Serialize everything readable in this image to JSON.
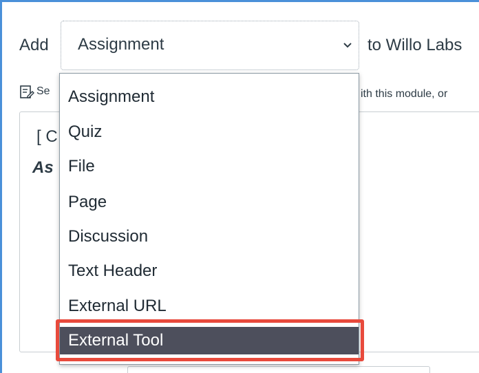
{
  "module_add": {
    "add_label": "Add",
    "selected_type": "Assignment",
    "to_label": "to Willo Labs",
    "info_text_left": "Se",
    "info_text_right": "ith this module, or",
    "content_line1": "[ C",
    "content_line2": "As"
  },
  "dropdown": {
    "options": [
      {
        "label": "Assignment",
        "selected": false
      },
      {
        "label": "Quiz",
        "selected": false
      },
      {
        "label": "File",
        "selected": false
      },
      {
        "label": "Page",
        "selected": false
      },
      {
        "label": "Discussion",
        "selected": false
      },
      {
        "label": "Text Header",
        "selected": false
      },
      {
        "label": "External URL",
        "selected": false
      },
      {
        "label": "External Tool",
        "selected": true
      }
    ]
  },
  "annotation": {
    "highlight_color": "#e84a3c",
    "highlighted_option": "External Tool"
  },
  "colors": {
    "frame_border": "#4a90d9",
    "selected_option_bg": "#4d4f5c",
    "text": "#2d3b45"
  },
  "icons": {
    "chevron": "chevron-down-icon",
    "info": "edit-document-icon"
  }
}
